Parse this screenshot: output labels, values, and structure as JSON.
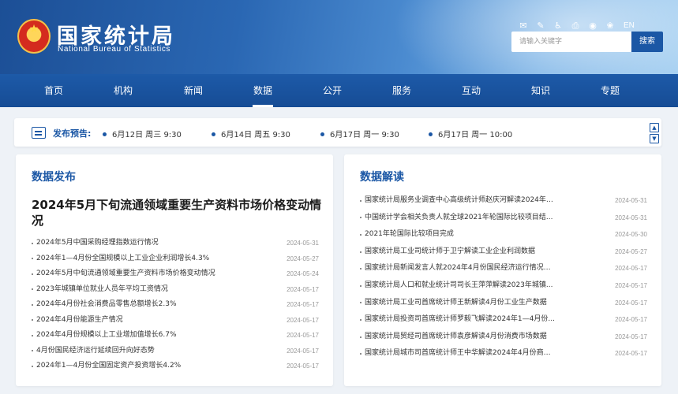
{
  "header": {
    "logo_cn": "国家统计局",
    "logo_en": "National Bureau of Statistics",
    "icons": [
      "mail-icon",
      "contact-icon",
      "accessibility-icon",
      "print-icon",
      "weibo-icon",
      "wechat-icon"
    ],
    "lang": "EN",
    "search_placeholder": "请输入关键字",
    "search_button": "搜索"
  },
  "nav": {
    "items": [
      "首页",
      "机构",
      "新闻",
      "数据",
      "公开",
      "服务",
      "互动",
      "知识",
      "专题"
    ],
    "active": "数据"
  },
  "notice": {
    "label": "发布预告:",
    "items": [
      "6月12日 周三 9:30",
      "6月14日 周五 9:30",
      "6月17日 周一 9:30",
      "6月17日 周一 10:00"
    ]
  },
  "left_panel": {
    "title": "数据发布",
    "feature": "2024年5月下旬流通领域重要生产资料市场价格变动情况",
    "items": [
      {
        "title": "2024年5月中国采购经理指数运行情况",
        "date": "2024-05-31"
      },
      {
        "title": "2024年1—4月份全国规模以上工业企业利润增长4.3%",
        "date": "2024-05-27"
      },
      {
        "title": "2024年5月中旬流通领域重要生产资料市场价格变动情况",
        "date": "2024-05-24"
      },
      {
        "title": "2023年城镇单位就业人员年平均工资情况",
        "date": "2024-05-17"
      },
      {
        "title": "2024年4月份社会消费品零售总额增长2.3%",
        "date": "2024-05-17"
      },
      {
        "title": "2024年4月份能源生产情况",
        "date": "2024-05-17"
      },
      {
        "title": "2024年4月份规模以上工业增加值增长6.7%",
        "date": "2024-05-17"
      },
      {
        "title": "4月份国民经济运行延续回升向好态势",
        "date": "2024-05-17"
      },
      {
        "title": "2024年1—4月份全国固定资产投资增长4.2%",
        "date": "2024-05-17"
      }
    ]
  },
  "right_panel": {
    "title": "数据解读",
    "items": [
      {
        "title": "国家统计局服务业调查中心高级统计师赵庆河解读2024年5...",
        "date": "2024-05-31"
      },
      {
        "title": "中国统计学会相关负责人就全球2021年轮国际比较项目结...",
        "date": "2024-05-31"
      },
      {
        "title": "2021年轮国际比较项目完成",
        "date": "2024-05-30"
      },
      {
        "title": "国家统计局工业司统计师于卫宁解读工业企业利润数据",
        "date": "2024-05-27"
      },
      {
        "title": "国家统计局新闻发言人就2024年4月份国民经济运行情况答...",
        "date": "2024-05-17"
      },
      {
        "title": "国家统计局人口和就业统计司司长王萍萍解读2023年城镇...",
        "date": "2024-05-17"
      },
      {
        "title": "国家统计局工业司首席统计师王新解读4月份工业生产数据",
        "date": "2024-05-17"
      },
      {
        "title": "国家统计局投资司首席统计师罗毅飞解读2024年1—4月份...",
        "date": "2024-05-17"
      },
      {
        "title": "国家统计局贸经司首席统计师袁彦解读4月份消费市场数据",
        "date": "2024-05-17"
      },
      {
        "title": "国家统计局城市司首席统计师王中华解读2024年4月份商品...",
        "date": "2024-05-17"
      }
    ]
  }
}
